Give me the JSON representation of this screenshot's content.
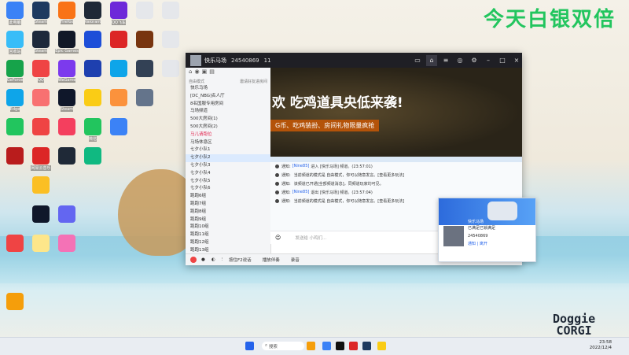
{
  "wallpaper": {
    "headline": "今天白银双倍",
    "brand_line1": "Doggie",
    "brand_line2": "CORGI"
  },
  "desktop_icons": [
    {
      "label": "此电脑",
      "color": "#3b82f6",
      "col": 0,
      "row": 0
    },
    {
      "label": "Steam",
      "color": "#1e3a5f",
      "col": 1,
      "row": 0
    },
    {
      "label": "Firefox",
      "color": "#f97316",
      "col": 2,
      "row": 0
    },
    {
      "label": "Valorant",
      "color": "#1f2937",
      "col": 3,
      "row": 0
    },
    {
      "label": "QQ飞车",
      "color": "#6d28d9",
      "col": 4,
      "row": 0
    },
    {
      "label": "",
      "color": "#e5e7eb",
      "col": 5,
      "row": 0
    },
    {
      "label": "",
      "color": "#e5e7eb",
      "col": 6,
      "row": 0
    },
    {
      "label": "回收站",
      "color": "#38bdf8",
      "col": 0,
      "row": 1
    },
    {
      "label": "Steam",
      "color": "#1e293b",
      "col": 1,
      "row": 1
    },
    {
      "label": "Epic Games",
      "color": "#111827",
      "col": 2,
      "row": 1
    },
    {
      "label": "",
      "color": "#1d4ed8",
      "col": 3,
      "row": 1
    },
    {
      "label": "",
      "color": "#dc2626",
      "col": 4,
      "row": 1
    },
    {
      "label": "",
      "color": "#78350f",
      "col": 5,
      "row": 1
    },
    {
      "label": "",
      "color": "#e5e7eb",
      "col": 6,
      "row": 1
    },
    {
      "label": "GeForce",
      "color": "#16a34a",
      "col": 0,
      "row": 2
    },
    {
      "label": "QQ",
      "color": "#ef4444",
      "col": 1,
      "row": 2
    },
    {
      "label": "WeGame",
      "color": "#7c3aed",
      "col": 2,
      "row": 2
    },
    {
      "label": "",
      "color": "#1e40af",
      "col": 3,
      "row": 2
    },
    {
      "label": "",
      "color": "#0ea5e9",
      "col": 4,
      "row": 2
    },
    {
      "label": "",
      "color": "#334155",
      "col": 5,
      "row": 2
    },
    {
      "label": "",
      "color": "#e5e7eb",
      "col": 6,
      "row": 2
    },
    {
      "label": "Edge",
      "color": "#0ea5e9",
      "col": 0,
      "row": 3
    },
    {
      "label": "",
      "color": "#f87171",
      "col": 1,
      "row": 3
    },
    {
      "label": "Steam",
      "color": "#0f172a",
      "col": 2,
      "row": 3
    },
    {
      "label": "",
      "color": "#facc15",
      "col": 3,
      "row": 3
    },
    {
      "label": "",
      "color": "#fb923c",
      "col": 4,
      "row": 3
    },
    {
      "label": "",
      "color": "#64748b",
      "col": 5,
      "row": 3
    },
    {
      "label": "",
      "color": "#22c55e",
      "col": 0,
      "row": 4
    },
    {
      "label": "",
      "color": "#ef4444",
      "col": 1,
      "row": 4
    },
    {
      "label": "",
      "color": "#f43f5e",
      "col": 2,
      "row": 4
    },
    {
      "label": "微信",
      "color": "#22c55e",
      "col": 3,
      "row": 4
    },
    {
      "label": "",
      "color": "#3b82f6",
      "col": 4,
      "row": 4
    },
    {
      "label": "",
      "color": "#b91c1c",
      "col": 0,
      "row": 5
    },
    {
      "label": "网易云音乐",
      "color": "#dc2626",
      "col": 1,
      "row": 5
    },
    {
      "label": "",
      "color": "#1f2937",
      "col": 2,
      "row": 5
    },
    {
      "label": "",
      "color": "#10b981",
      "col": 3,
      "row": 5
    },
    {
      "label": "",
      "color": "#fbbf24",
      "col": 1,
      "row": 6
    },
    {
      "label": "",
      "color": "#0f172a",
      "col": 1,
      "row": 7
    },
    {
      "label": "",
      "color": "#6366f1",
      "col": 2,
      "row": 7
    },
    {
      "label": "",
      "color": "#ef4444",
      "col": 0,
      "row": 8
    },
    {
      "label": "",
      "color": "#fde68a",
      "col": 1,
      "row": 8
    },
    {
      "label": "",
      "color": "#f472b6",
      "col": 2,
      "row": 8
    },
    {
      "label": "",
      "color": "#f59e0b",
      "col": 0,
      "row": 10
    }
  ],
  "window": {
    "title": "快乐马场",
    "id": "24540869",
    "count": "11",
    "left_head_a": "自由模式",
    "left_head_b": "邀请好友进房间",
    "channels": [
      {
        "label": "快乐马场",
        "cls": ""
      },
      {
        "label": "[DC_NBG]名人厅",
        "cls": ""
      },
      {
        "label": "8名国服专用房间",
        "cls": ""
      },
      {
        "label": "马场频道",
        "cls": ""
      },
      {
        "label": "500大房间(1)",
        "cls": ""
      },
      {
        "label": "500大房间(2)",
        "cls": ""
      },
      {
        "label": "马儿请跑位",
        "cls": "red"
      },
      {
        "label": "马场休息区",
        "cls": ""
      },
      {
        "label": "七夕小队1",
        "cls": ""
      },
      {
        "label": "七夕小队2",
        "cls": "sel"
      },
      {
        "label": "七夕小队3",
        "cls": ""
      },
      {
        "label": "七夕小队4",
        "cls": ""
      },
      {
        "label": "七夕小队5",
        "cls": ""
      },
      {
        "label": "七夕小队6",
        "cls": ""
      },
      {
        "label": "跑跑6组",
        "cls": ""
      },
      {
        "label": "跑跑7组",
        "cls": ""
      },
      {
        "label": "跑跑8组",
        "cls": ""
      },
      {
        "label": "跑跑9组",
        "cls": ""
      },
      {
        "label": "跑跑10组",
        "cls": ""
      },
      {
        "label": "跑跑11组",
        "cls": ""
      },
      {
        "label": "跑跑12组",
        "cls": ""
      },
      {
        "label": "跑跑13组",
        "cls": ""
      },
      {
        "label": "跑跑14组",
        "cls": ""
      }
    ],
    "banner_title": "欢 吃鸡道具央低来袭!",
    "banner_sub": "G币、吃鸡装扮、房间礼物限量疯抢",
    "messages": [
      {
        "pre": "通知:",
        "hl": "[Nine85]",
        "text": "进入 [快乐马场] 频道。(23:57:01)"
      },
      {
        "pre": "通知:",
        "hl": "",
        "text": "当前频道的模式是 自由模式，你可以随意发言。[查看更多玩法]"
      },
      {
        "pre": "通知:",
        "hl": "",
        "text": "该频道已开通[全部频道消息]，同频道玩家均可见。"
      },
      {
        "pre": "通知:",
        "hl": "[Nine85]",
        "text": "退出 [快乐马场] 频道。(23:57:04)"
      },
      {
        "pre": "通知:",
        "hl": "",
        "text": "当前频道的模式是 自由模式，你可以随意发言。[查看更多玩法]"
      }
    ],
    "input_placeholder": "发送给 小鸡们...",
    "bottom": [
      "按住F2说话",
      "播放伴奏",
      "录音"
    ]
  },
  "popup": {
    "name": "快乐马场",
    "sub": "已满足已锁满足",
    "id": "24540869",
    "ops": "通知 | 离开"
  },
  "taskbar": {
    "search": "搜索",
    "time": "23:58",
    "date": "2022/12/4"
  }
}
